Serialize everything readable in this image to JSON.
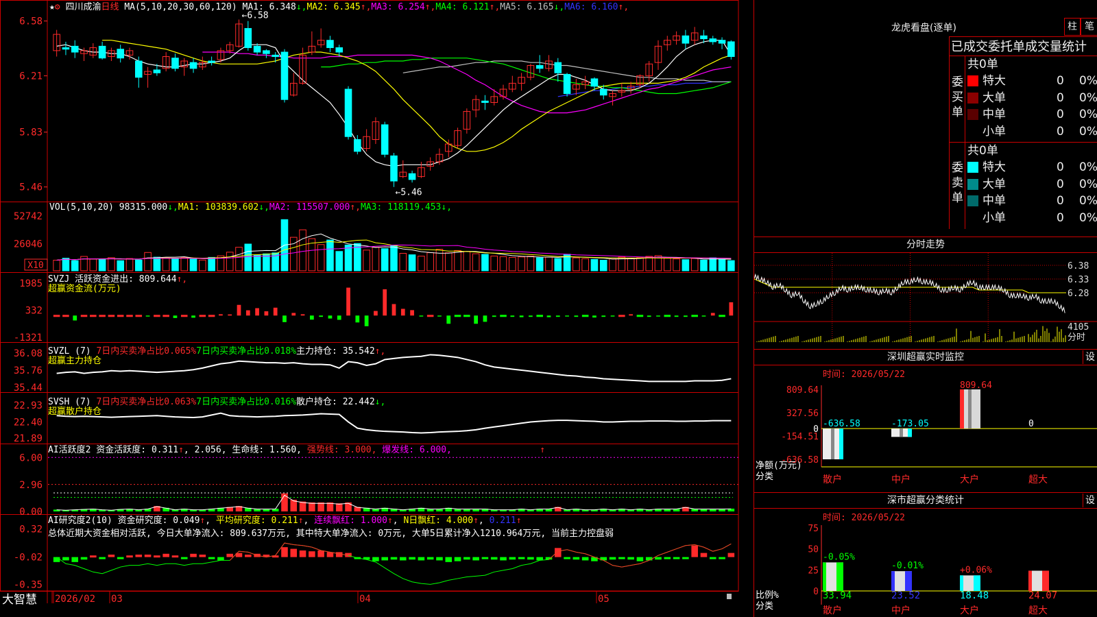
{
  "colors": {
    "up": "#ff2a2a",
    "down": "#00ffff",
    "vol_up": "#ff2a2a",
    "vol_down": "#00ffff",
    "grid": "#cc0000",
    "ma1": "#ffffff",
    "ma2": "#ffff00",
    "ma3": "#ff00ff",
    "ma4": "#00ff00",
    "ma5": "#c0c0c0",
    "ma6": "#3333ff",
    "green": "#00ff00"
  },
  "chart_data": {
    "type": "candlestick",
    "stock_name": "四川成渝",
    "period": "日线",
    "ma_label": "MA(5,10,20,30,60,120)",
    "ma_values": [
      {
        "label": "MA1: 6.348",
        "arrow": "↓"
      },
      {
        "label": "MA2: 6.345",
        "arrow": "↑"
      },
      {
        "label": "MA3: 6.254",
        "arrow": "↑"
      },
      {
        "label": "MA4: 6.121",
        "arrow": "↑"
      },
      {
        "label": "MA5: 6.165",
        "arrow": "↓"
      },
      {
        "label": "MA6: 6.160",
        "arrow": "↑"
      }
    ],
    "y_ticks": [
      "6.58",
      "6.21",
      "5.83",
      "5.46"
    ],
    "ylim": [
      5.38,
      6.62
    ],
    "high_marker": "6.58",
    "low_marker": "5.46",
    "candles": [
      [
        6.38,
        6.49,
        6.52,
        6.34
      ],
      [
        6.4,
        6.39,
        6.44,
        6.35
      ],
      [
        6.41,
        6.37,
        6.45,
        6.33
      ],
      [
        6.36,
        6.38,
        6.4,
        6.31
      ],
      [
        6.35,
        6.4,
        6.43,
        6.33
      ],
      [
        6.41,
        6.33,
        6.44,
        6.32
      ],
      [
        6.34,
        6.38,
        6.4,
        6.31
      ],
      [
        6.39,
        6.33,
        6.42,
        6.3
      ],
      [
        6.35,
        6.38,
        6.4,
        6.32
      ],
      [
        6.31,
        6.2,
        6.34,
        6.13
      ],
      [
        6.22,
        6.24,
        6.27,
        6.13
      ],
      [
        6.25,
        6.23,
        6.29,
        6.21
      ],
      [
        6.26,
        6.34,
        6.37,
        6.24
      ],
      [
        6.33,
        6.26,
        6.36,
        6.24
      ],
      [
        6.27,
        6.31,
        6.33,
        6.21
      ],
      [
        6.3,
        6.26,
        6.33,
        6.23
      ],
      [
        6.27,
        6.3,
        6.34,
        6.25
      ],
      [
        6.31,
        6.3,
        6.34,
        6.28
      ],
      [
        6.32,
        6.38,
        6.4,
        6.3
      ],
      [
        6.38,
        6.42,
        6.44,
        6.36
      ],
      [
        6.41,
        6.56,
        6.59,
        6.4
      ],
      [
        6.53,
        6.4,
        6.58,
        6.38
      ],
      [
        6.41,
        6.37,
        6.43,
        6.35
      ],
      [
        6.38,
        6.36,
        6.39,
        6.33
      ],
      [
        6.35,
        6.34,
        6.37,
        6.3
      ],
      [
        6.37,
        6.05,
        6.39,
        6.03
      ],
      [
        6.08,
        6.16,
        6.23,
        6.07
      ],
      [
        6.16,
        6.35,
        6.4,
        6.15
      ],
      [
        6.37,
        6.41,
        6.51,
        6.35
      ],
      [
        6.42,
        6.45,
        6.53,
        6.4
      ],
      [
        6.45,
        6.4,
        6.48,
        6.37
      ],
      [
        6.4,
        6.37,
        6.42,
        6.34
      ],
      [
        6.12,
        5.8,
        6.14,
        5.78
      ],
      [
        5.78,
        5.7,
        5.81,
        5.68
      ],
      [
        5.72,
        5.8,
        5.85,
        5.7
      ],
      [
        5.78,
        5.9,
        5.93,
        5.75
      ],
      [
        5.88,
        5.68,
        5.9,
        5.66
      ],
      [
        5.67,
        5.5,
        5.69,
        5.46
      ],
      [
        5.53,
        5.56,
        5.64,
        5.52
      ],
      [
        5.55,
        5.51,
        5.57,
        5.49
      ],
      [
        5.53,
        5.59,
        5.63,
        5.52
      ],
      [
        5.6,
        5.63,
        5.66,
        5.57
      ],
      [
        5.63,
        5.68,
        5.72,
        5.61
      ],
      [
        5.7,
        5.75,
        5.78,
        5.66
      ],
      [
        5.74,
        5.84,
        5.86,
        5.72
      ],
      [
        5.85,
        5.97,
        5.99,
        5.82
      ],
      [
        5.98,
        6.05,
        6.08,
        5.93
      ],
      [
        6.04,
        6.03,
        6.08,
        5.98
      ],
      [
        6.03,
        6.07,
        6.12,
        6.01
      ],
      [
        6.07,
        6.12,
        6.15,
        6.05
      ],
      [
        6.12,
        6.16,
        6.21,
        6.1
      ],
      [
        6.16,
        6.2,
        6.23,
        6.11
      ],
      [
        6.2,
        6.28,
        6.29,
        6.18
      ],
      [
        6.28,
        6.26,
        6.35,
        6.23
      ],
      [
        6.26,
        6.31,
        6.35,
        6.24
      ],
      [
        6.3,
        6.23,
        6.33,
        6.17
      ],
      [
        6.22,
        6.09,
        6.23,
        6.07
      ],
      [
        6.12,
        6.15,
        6.19,
        6.08
      ],
      [
        6.15,
        6.17,
        6.21,
        6.12
      ],
      [
        6.19,
        6.14,
        6.2,
        6.11
      ],
      [
        6.12,
        6.08,
        6.15,
        6.05
      ],
      [
        6.07,
        6.09,
        6.11,
        6.01
      ],
      [
        6.1,
        6.11,
        6.16,
        6.07
      ],
      [
        6.12,
        6.14,
        6.17,
        6.09
      ],
      [
        6.15,
        6.21,
        6.22,
        6.13
      ],
      [
        6.21,
        6.29,
        6.31,
        6.17
      ],
      [
        6.3,
        6.41,
        6.45,
        6.25
      ],
      [
        6.42,
        6.45,
        6.48,
        6.38
      ],
      [
        6.45,
        6.48,
        6.51,
        6.42
      ],
      [
        6.48,
        6.43,
        6.52,
        6.39
      ],
      [
        6.45,
        6.5,
        6.54,
        6.42
      ],
      [
        6.48,
        6.46,
        6.52,
        6.43
      ],
      [
        6.46,
        6.44,
        6.48,
        6.42
      ],
      [
        6.45,
        6.43,
        6.47,
        6.39
      ],
      [
        6.44,
        6.34,
        6.45,
        6.32
      ]
    ],
    "ma_series": {
      "ma1": [
        6.41,
        6.42,
        6.4,
        6.38,
        6.37,
        6.37,
        6.36,
        6.36,
        6.34,
        6.31,
        6.29,
        6.28,
        6.27,
        6.27,
        6.28,
        6.29,
        6.29,
        6.3,
        6.31,
        6.33,
        6.38,
        6.42,
        6.42,
        6.42,
        6.4,
        6.3,
        6.24,
        6.18,
        6.13,
        6.08,
        6.03,
        5.95,
        5.86,
        5.76,
        5.68,
        5.63,
        5.61,
        5.6,
        5.61,
        5.61,
        5.61,
        5.61,
        5.63,
        5.65,
        5.69,
        5.74,
        5.8,
        5.86,
        5.92,
        5.98,
        6.03,
        6.07,
        6.11,
        6.15,
        6.19,
        6.22,
        6.22,
        6.2,
        6.18,
        6.15,
        6.12,
        6.11,
        6.11,
        6.11,
        6.13,
        6.16,
        6.21,
        6.27,
        6.34,
        6.39,
        6.42,
        6.44,
        6.45,
        6.45,
        6.35
      ],
      "ma2": [
        6.45,
        6.45,
        6.44,
        6.43,
        6.42,
        6.41,
        6.4,
        6.39,
        6.37,
        6.35,
        6.33,
        6.31,
        6.3,
        6.29,
        6.29,
        6.29,
        6.29,
        6.29,
        6.3,
        6.31,
        6.33,
        6.35,
        6.36,
        6.37,
        6.37,
        6.36,
        6.35,
        6.33,
        6.31,
        6.28,
        6.24,
        6.18,
        6.12,
        6.05,
        5.99,
        5.93,
        5.87,
        5.8,
        5.75,
        5.72,
        5.7,
        5.7,
        5.71,
        5.73,
        5.76,
        5.8,
        5.85,
        5.89,
        5.93,
        5.97,
        6.0,
        6.03,
        6.06,
        6.09,
        6.12,
        6.14,
        6.15,
        6.16,
        6.16,
        6.16,
        6.16,
        6.16,
        6.17,
        6.18,
        6.2,
        6.23,
        6.27,
        6.3,
        6.33,
        6.35
      ],
      "ma3": [
        6.37,
        6.37,
        6.37,
        6.37,
        6.36,
        6.36,
        6.35,
        6.35,
        6.34,
        6.34,
        6.33,
        6.33,
        6.33,
        6.33,
        6.34,
        6.34,
        6.34,
        6.35,
        6.35,
        6.35,
        6.35,
        6.35,
        6.35,
        6.35,
        6.34,
        6.33,
        6.31,
        6.28,
        6.25,
        6.22,
        6.18,
        6.15,
        6.11,
        6.07,
        6.04,
        6.01,
        5.99,
        5.97,
        5.96,
        5.96,
        5.96,
        5.97,
        5.98,
        6.0,
        6.02,
        6.04,
        6.06,
        6.08,
        6.1,
        6.12,
        6.13,
        6.15,
        6.17,
        6.19,
        6.21,
        6.23,
        6.25,
        6.26,
        6.27
      ],
      "ma4": [
        6.27,
        6.27,
        6.28,
        6.29,
        6.29,
        6.3,
        6.3,
        6.31,
        6.31,
        6.31,
        6.32,
        6.32,
        6.33,
        6.33,
        6.33,
        6.33,
        6.33,
        6.32,
        6.31,
        6.3,
        6.29,
        6.27,
        6.25,
        6.23,
        6.21,
        6.19,
        6.18,
        6.17,
        6.16,
        6.15,
        6.14,
        6.14,
        6.13,
        6.13,
        6.12,
        6.11,
        6.1,
        6.09,
        6.09,
        6.09,
        6.1,
        6.11,
        6.12,
        6.13,
        6.15,
        6.17
      ],
      "ma5": [
        6.23,
        6.24,
        6.25,
        6.26,
        6.27,
        6.27,
        6.28,
        6.29,
        6.3,
        6.3,
        6.31,
        6.31,
        6.31,
        6.31,
        6.3,
        6.3,
        6.29,
        6.28,
        6.28,
        6.27,
        6.26,
        6.25,
        6.24,
        6.23,
        6.22,
        6.21,
        6.2,
        6.2,
        6.19,
        6.19,
        6.19,
        6.18,
        6.18,
        6.18,
        6.17,
        6.17,
        6.17
      ],
      "ma6": [
        6.07,
        6.08,
        6.09,
        6.1,
        6.11,
        6.11,
        6.12,
        6.13,
        6.13,
        6.14,
        6.14,
        6.15,
        6.15,
        6.15,
        6.16,
        6.16,
        6.16,
        6.17,
        6.17,
        6.17
      ]
    },
    "volume": {
      "label": "VOL(5,10,20)",
      "value": "98315.000",
      "value_arrow": "↓",
      "ma": [
        {
          "label": "MA1: 103839.602",
          "arrow": "↓"
        },
        {
          "label": "MA2: 115507.000",
          "arrow": "↑"
        },
        {
          "label": "MA3: 118119.453",
          "arrow": "↓"
        }
      ],
      "y_ticks": [
        "52742",
        "26046"
      ],
      "unit": "X10",
      "ymax": 56000,
      "values": [
        10200,
        12100,
        9800,
        13800,
        11200,
        10900,
        12600,
        9700,
        11800,
        10400,
        17600,
        13100,
        12400,
        11900,
        12700,
        11200,
        10300,
        12900,
        14400,
        17900,
        22600,
        25700,
        15000,
        16300,
        17200,
        49200,
        32200,
        39400,
        30900,
        25200,
        29600,
        18600,
        24800,
        26200,
        19900,
        22700,
        21300,
        24200,
        16800,
        15400,
        14100,
        17400,
        20700,
        17300,
        19500,
        18600,
        16400,
        15800,
        14200,
        13600,
        12900,
        13300,
        14100,
        12500,
        13100,
        11800,
        15900,
        12400,
        11600,
        10900,
        10200,
        11500,
        13200,
        11800,
        12600,
        13900,
        14600,
        12100,
        11400,
        10700,
        11800,
        10300,
        12500,
        11200,
        9800
      ]
    },
    "svzj": {
      "title": "SVZJ 活跃资金进出: 809.644↑,",
      "subtitle": "超赢资金流(万元)",
      "y_ticks": [
        "1985",
        "332",
        "-1321"
      ],
      "ylim": [
        -1450,
        2100
      ],
      "values": [
        0,
        0,
        -400,
        0,
        0,
        0,
        0,
        0,
        0,
        0,
        0,
        260,
        0,
        0,
        220,
        0,
        0,
        510,
        0,
        -700,
        220,
        0,
        0,
        0,
        0,
        -250,
        0,
        0,
        0,
        0,
        0,
        0,
        -180,
        0,
        -250,
        0,
        370,
        0,
        -660,
        280,
        -180,
        -810,
        -70,
        0,
        -400,
        -200,
        0,
        0,
        -440,
        0,
        -210,
        0,
        0,
        0,
        0,
        -150,
        0,
        0,
        0,
        0,
        0,
        0,
        0,
        0,
        -180,
        0,
        0,
        0,
        0,
        0,
        -160,
        0,
        0,
        0,
        0,
        0,
        0,
        0,
        0,
        0,
        0,
        240,
        0,
        0,
        0,
        0,
        0,
        0,
        0,
        810
      ],
      "pos_idx": [
        11,
        14,
        17,
        20,
        22,
        24,
        26,
        28,
        33,
        35,
        37,
        39,
        41,
        44
      ]
    },
    "svzl": {
      "title": "SVZL (7)",
      "t1": "7日内买卖净占比0.065%",
      "t2": "7日内买卖净占比0.018%",
      "t3": "主力持仓: 35.542↑,",
      "subtitle": "超赢主力持仓",
      "y_ticks": [
        "36.08",
        "35.76",
        "35.44"
      ],
      "ylim": [
        35.4,
        36.12
      ]
    },
    "svsh": {
      "title": "SVSH (7)",
      "t1": "7日内买卖净占比0.063%",
      "t2": "7日内买卖净占比0.016%",
      "t3": "散户持仓: 22.442↓,",
      "subtitle": "超赢散户持仓",
      "y_ticks": [
        "22.93",
        "22.40",
        "21.89"
      ],
      "ylim": [
        21.82,
        23.0
      ]
    },
    "ai1": {
      "title": "AI活跃度2 资金活跃度: 0.311↑, 2.056, 生命线: 1.560, 强势线: 3.000, 爆发线: 6.000,",
      "y_ticks": [
        "6.00",
        "2.96",
        "0.00"
      ],
      "ylim": [
        0,
        6.4
      ]
    },
    "ai2": {
      "title": "AI研究度2(10) 资金研究度: 0.049↑, 平均研究度: 0.211↑, 连续飘红: 1.000↑, N日飘红: 4.000↑, 0.211↑",
      "summary": "总体近期大资金相对活跃, 今日大单净流入: 809.637万元, 其中特大单净流入: 0万元, 大单5日累计净入1210.964万元, 当前主力控盘弱",
      "y_ticks": [
        "0.32",
        "-0.02",
        "-0.35"
      ],
      "ylim": [
        -0.38,
        0.35
      ]
    },
    "x_labels": [
      "2026/02",
      "03",
      "04",
      "05"
    ],
    "intraday": {
      "title": "分时走势",
      "y_ticks": [
        "6.38",
        "6.33",
        "6.28"
      ],
      "vol_tick": "4105",
      "vol_unit": "分时",
      "ylim": [
        6.2,
        6.4
      ],
      "price": [
        6.34,
        6.33,
        6.32,
        6.3,
        6.31,
        6.29,
        6.27,
        6.28,
        6.25,
        6.23,
        6.24,
        6.25,
        6.27,
        6.28,
        6.3,
        6.29,
        6.3,
        6.3,
        6.29,
        6.29,
        6.28,
        6.29,
        6.28,
        6.3,
        6.32,
        6.32,
        6.33,
        6.32,
        6.32,
        6.31,
        6.29,
        6.29,
        6.3,
        6.29,
        6.31,
        6.32,
        6.3,
        6.3,
        6.3,
        6.3,
        6.29,
        6.27,
        6.27,
        6.27,
        6.26,
        6.27,
        6.25,
        6.25,
        6.25,
        6.23,
        6.21
      ],
      "avg": [
        6.33,
        6.32,
        6.31,
        6.3,
        6.3,
        6.3,
        6.3,
        6.3,
        6.3,
        6.3,
        6.3,
        6.3,
        6.3,
        6.3,
        6.3,
        6.3,
        6.3,
        6.3,
        6.3,
        6.3,
        6.3,
        6.3,
        6.3,
        6.3,
        6.3,
        6.3,
        6.3,
        6.3,
        6.3,
        6.3,
        6.3,
        6.3,
        6.3,
        6.3,
        6.3,
        6.3,
        6.29,
        6.29,
        6.29,
        6.29,
        6.29,
        6.29,
        6.29,
        6.29,
        6.28,
        6.28,
        6.28,
        6.28,
        6.28,
        6.28,
        6.28
      ]
    },
    "sz_monitor": {
      "title": "深圳超赢实时监控",
      "date_label": "时间: 2026/05/22",
      "y_ticks": [
        "809.64",
        "327.56",
        "-154.51",
        "-636.58"
      ],
      "y_label": "净额(万元)",
      "x_title": "分类",
      "categories": [
        "散户",
        "中户",
        "大户",
        "超大"
      ],
      "values": [
        -636.58,
        -173.05,
        809.64,
        0
      ],
      "value_labels": [
        "-636.58",
        "-173.05",
        "809.64",
        "0"
      ],
      "zero_tick": "0",
      "ylim": [
        -636.58,
        809.64
      ]
    },
    "sz_stats": {
      "title": "深市超赢分类统计",
      "date_label": "时间: 2026/05/22",
      "y_ticks": [
        "75",
        "50",
        "25",
        "0"
      ],
      "y_label": "比例%",
      "x_title": "分类",
      "categories": [
        "散户",
        "中户",
        "大户",
        "超大"
      ],
      "values": [
        33.94,
        23.52,
        18.48,
        24.07
      ],
      "value_labels": [
        "33.94",
        "23.52",
        "18.48",
        "24.07"
      ],
      "change_labels": [
        "-0.05%",
        "-0.01%",
        "+0.06%",
        ""
      ],
      "bar_colors": [
        "#00ff00",
        "#3333ff",
        "#00ffff",
        "#ff2a2a"
      ],
      "ylim": [
        0,
        75
      ]
    }
  },
  "longhu": {
    "title": "龙虎看盘(逐单)",
    "btn1": "柱",
    "btn2": "笔",
    "subtitle": "已成交委托单成交量统计",
    "buy": {
      "side": "委买单",
      "total": "共0单",
      "rows": [
        {
          "label": "特大",
          "count": "0",
          "pct": "0%",
          "color": "#ff0000"
        },
        {
          "label": "大单",
          "count": "0",
          "pct": "0%",
          "color": "#8b0000"
        },
        {
          "label": "中单",
          "count": "0",
          "pct": "0%",
          "color": "#5a0000"
        },
        {
          "label": "小单",
          "count": "0",
          "pct": "0%",
          "color": "#000000"
        }
      ]
    },
    "sell": {
      "side": "委卖单",
      "total": "共0单",
      "rows": [
        {
          "label": "特大",
          "count": "0",
          "pct": "0%",
          "color": "#00ffff"
        },
        {
          "label": "大单",
          "count": "0",
          "pct": "0%",
          "color": "#008b8b"
        },
        {
          "label": "中单",
          "count": "0",
          "pct": "0%",
          "color": "#006a6a"
        },
        {
          "label": "小单",
          "count": "0",
          "pct": "0%",
          "color": "#000000"
        }
      ]
    }
  },
  "footer": {
    "brand": "大智慧",
    "set_label": "设"
  }
}
